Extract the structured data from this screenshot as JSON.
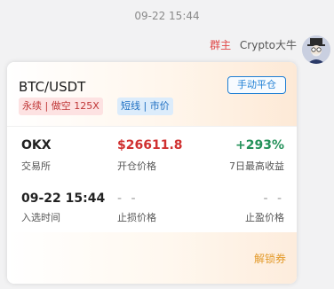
{
  "message": {
    "timestamp": "09-22 15:44",
    "sender_role": "群主",
    "sender_name": "Crypto大牛"
  },
  "card": {
    "pair": "BTC/USDT",
    "close_button": "手动平仓",
    "tags": [
      "永续 | 做空 125X",
      "短线 | 市价"
    ],
    "fields": {
      "exchange": {
        "value": "OKX",
        "label": "交易所"
      },
      "open_price": {
        "value": "$26611.8",
        "label": "开仓价格"
      },
      "max_gain": {
        "value": "+293%",
        "label": "7日最高收益"
      },
      "entry_time": {
        "value": "09-22 15:44",
        "label": "入选时间"
      },
      "stop_loss": {
        "value": "- -",
        "label": "止损价格"
      },
      "take_profit": {
        "value": "- -",
        "label": "止盈价格"
      }
    },
    "unlock_label": "解锁券"
  },
  "colors": {
    "accent_blue": "#1f7fd4",
    "price_red": "#d03030",
    "gain_green": "#24915a",
    "unlock_orange": "#e39a2a"
  }
}
